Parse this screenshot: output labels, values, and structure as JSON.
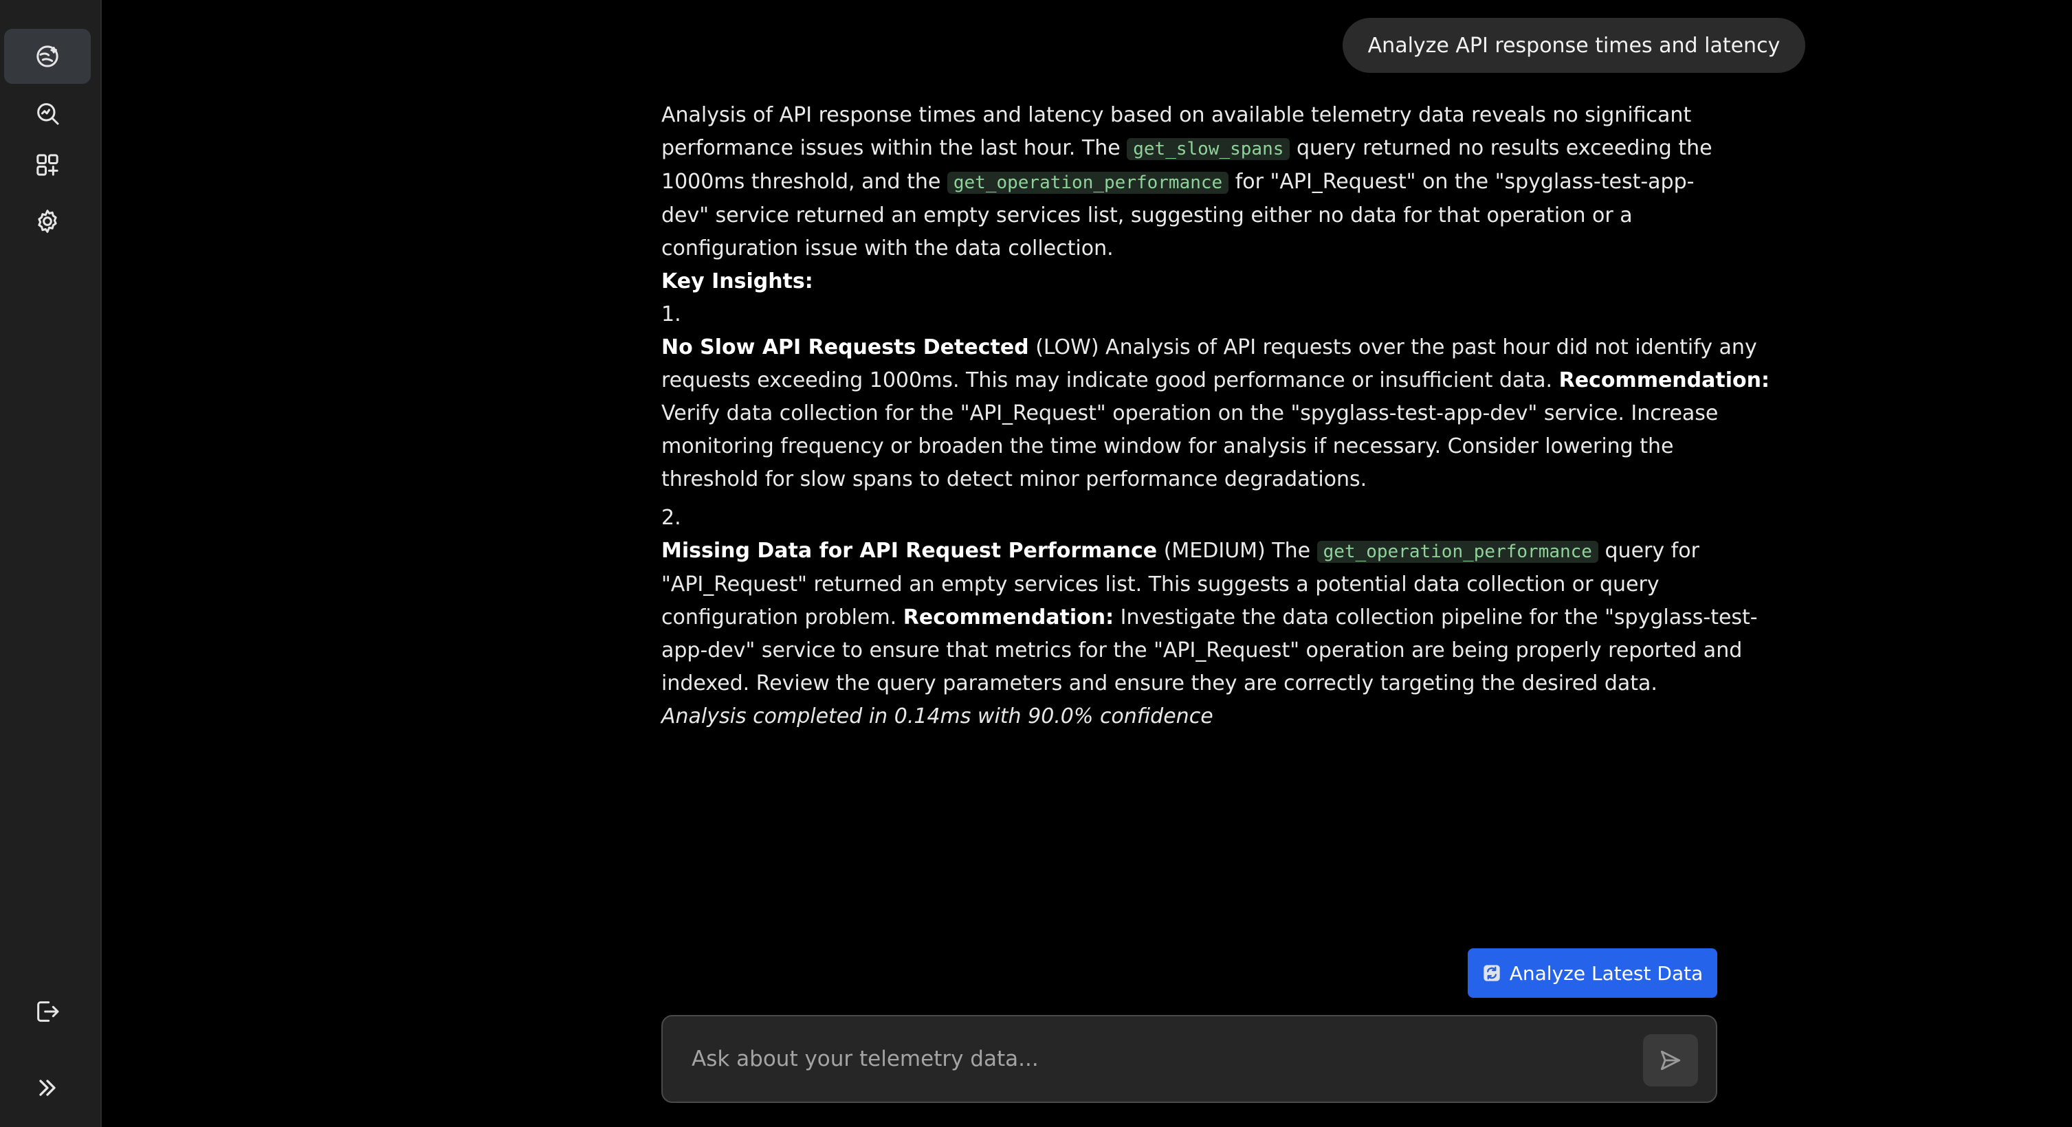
{
  "sidebar": {
    "items": [
      {
        "icon": "chat-sparkle-icon",
        "active": true
      },
      {
        "icon": "search-analytics-icon",
        "active": false
      },
      {
        "icon": "widgets-add-icon",
        "active": false
      },
      {
        "icon": "gear-icon",
        "active": false
      }
    ],
    "bottom": [
      {
        "icon": "logout-icon"
      },
      {
        "icon": "expand-sidebar-icon"
      }
    ]
  },
  "conversation": {
    "user_message": "Analyze API response times and latency",
    "response": {
      "p1": {
        "l1": "Analysis of API response times and latency based on available telemetry data reveals no significant",
        "l2a": "performance issues within the last hour. The",
        "l2code": "get_slow_spans",
        "l2b": "query returned no results exceeding the",
        "l3a": "1000ms threshold, and the",
        "l3code": "get_operation_performance",
        "l3b": "for \"API_Request\" on the \"spyglass-test-app-",
        "l4": "dev\" service returned an empty services list, suggesting either no data for that operation or a",
        "l5": "configuration issue with the data collection."
      },
      "key_insights_heading": "Key Insights:",
      "insight1": {
        "number": "1.",
        "title": "No Slow API Requests Detected",
        "l1": "(LOW) Analysis of API requests over the past hour did not identify any",
        "l2a": "requests exceeding 1000ms. This may indicate good performance or insufficient data.",
        "rec_label": "Recommendation:",
        "l3": "Verify data collection for the \"API_Request\" operation on the \"spyglass-test-app-dev\" service. Increase",
        "l4": "monitoring frequency or broaden the time window for analysis if necessary. Consider lowering the",
        "l5": "threshold for slow spans to detect minor performance degradations."
      },
      "insight2": {
        "number": "2.",
        "title": "Missing Data for API Request Performance",
        "l1a": "(MEDIUM) The",
        "l1code": "get_operation_performance",
        "l1b": "query for",
        "l2": "\"API_Request\" returned an empty services list. This suggests a potential data collection or query",
        "l3a": "configuration problem.",
        "rec_label": "Recommendation:",
        "l3b": "Investigate the data collection pipeline for the \"spyglass-test-",
        "l4": "app-dev\" service to ensure that metrics for the \"API_Request\" operation are being properly reported and",
        "l5": "indexed. Review the query parameters and ensure they are correctly targeting the desired data."
      },
      "footer": "Analysis completed in 0.14ms with 90.0% confidence"
    }
  },
  "actions": {
    "analyze_button_label": "Analyze Latest Data",
    "analyze_button_icon": "refresh-icon"
  },
  "composer": {
    "placeholder": "Ask about your telemetry data...",
    "value": "",
    "send_icon": "send-icon"
  },
  "colors": {
    "background": "#000000",
    "sidebar": "#1f1f1f",
    "accent": "#2563eb",
    "code_text": "#8fd39a"
  }
}
